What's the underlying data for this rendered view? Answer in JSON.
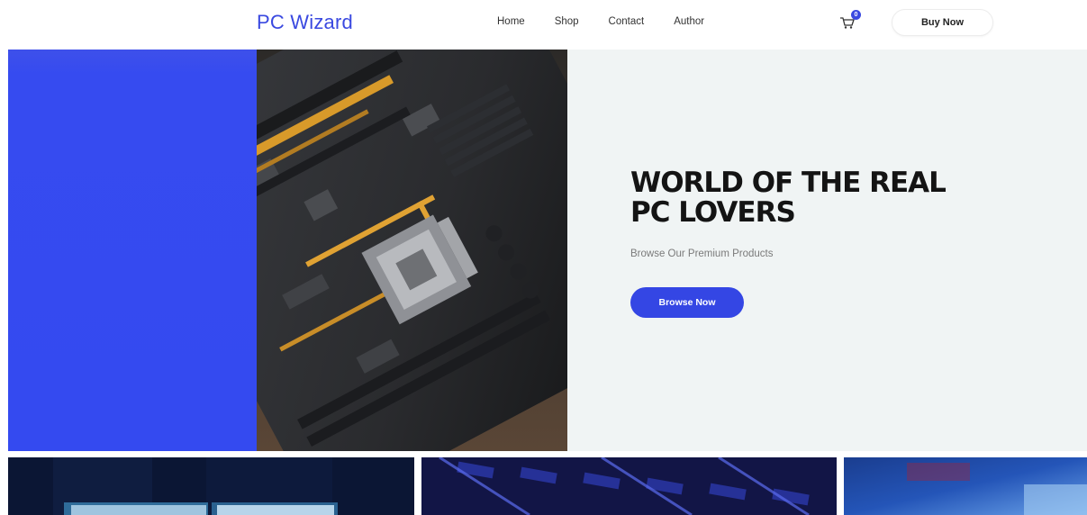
{
  "header": {
    "brand": "PC Wizard",
    "nav": [
      "Home",
      "Shop",
      "Contact",
      "Author"
    ],
    "cart_count": "0",
    "buy_label": "Buy Now"
  },
  "hero": {
    "title_line1": "WORLD OF THE REAL",
    "title_line2": "PC LOVERS",
    "subtitle": "Browse Our Premium Products",
    "cta_label": "Browse Now",
    "image_subject": "motherboard-photo"
  },
  "tiles": [
    "monitors-photo",
    "keyboard-photo",
    "blue-blur-photo"
  ],
  "colors": {
    "accent": "#3a49e0",
    "hero_blue": "#344af0",
    "hero_panel": "#f0f4f4",
    "text_dark": "#141414"
  },
  "icons": [
    "cart-icon"
  ]
}
